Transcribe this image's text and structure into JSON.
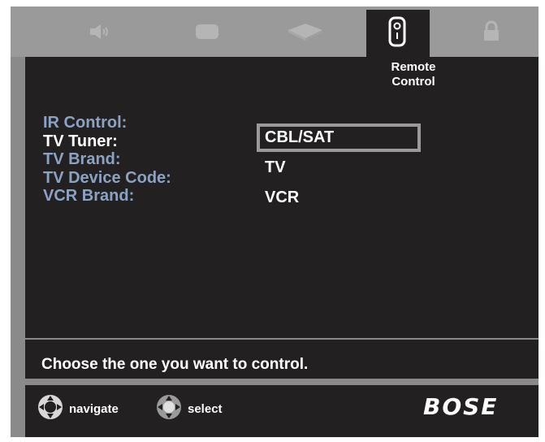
{
  "tabs": [
    {
      "icon": "speaker-icon"
    },
    {
      "icon": "tv-screen-icon"
    },
    {
      "icon": "disc-player-icon"
    },
    {
      "icon": "remote-control-icon",
      "label": "Remote Control"
    },
    {
      "icon": "lock-icon"
    }
  ],
  "menu": {
    "items": [
      "IR Control:",
      "TV Tuner:",
      "TV Brand:",
      "TV Device Code:",
      "VCR Brand:"
    ],
    "active_index": 1
  },
  "options": {
    "items": [
      "CBL/SAT",
      "TV",
      "VCR"
    ],
    "selected_index": 0
  },
  "help": {
    "text": "Choose the one you want to control."
  },
  "footer": {
    "navigate_label": "navigate",
    "select_label": "select",
    "logo": "BOSE"
  },
  "colors": {
    "panel": "#232021",
    "frame": "#8a8a8a",
    "inactive_text": "#8aa3c4",
    "active_text": "#ffffff"
  }
}
